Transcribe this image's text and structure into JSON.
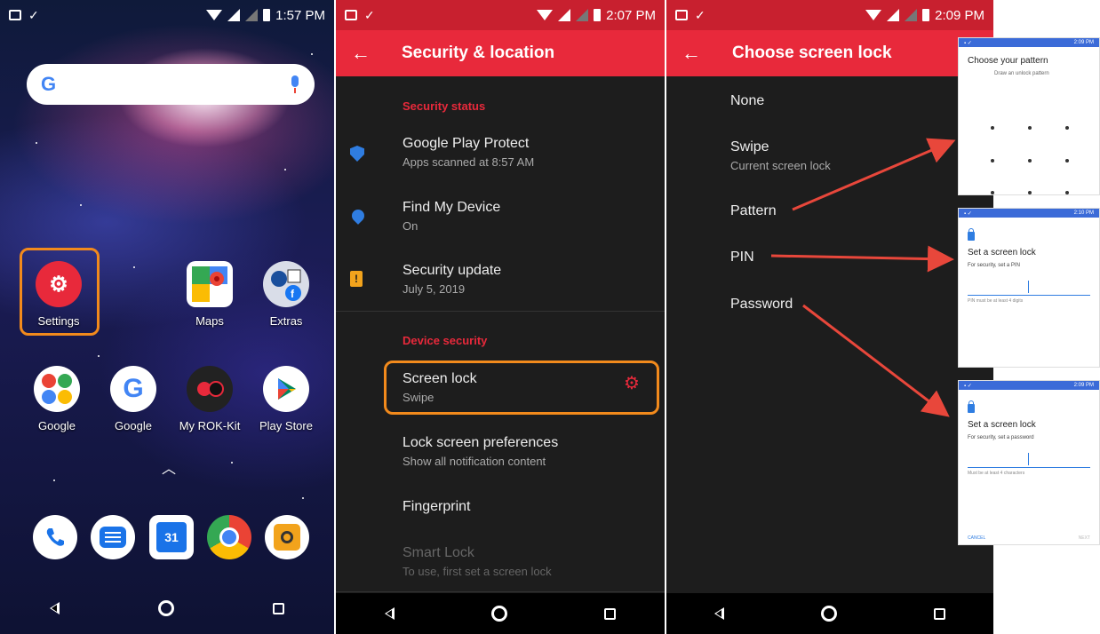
{
  "home": {
    "status_time": "1:57 PM",
    "search_logo": "G",
    "apps_row1": [
      {
        "label": "Settings"
      },
      {
        "label": "Maps"
      },
      {
        "label": "Extras"
      }
    ],
    "apps_row2": [
      {
        "label": "Google"
      },
      {
        "label": "Google"
      },
      {
        "label": "My ROK-Kit"
      },
      {
        "label": "Play Store"
      }
    ],
    "dock": [
      "phone-icon",
      "messages-icon",
      "calendar-icon",
      "chrome-icon",
      "audio-app-icon"
    ],
    "calendar_day": "31"
  },
  "security": {
    "status_time": "2:07 PM",
    "title": "Security & location",
    "section_status": "Security status",
    "items_status": [
      {
        "title": "Google Play Protect",
        "subtitle": "Apps scanned at 8:57 AM"
      },
      {
        "title": "Find My Device",
        "subtitle": "On"
      },
      {
        "title": "Security update",
        "subtitle": "July 5, 2019"
      }
    ],
    "section_device": "Device security",
    "screen_lock": {
      "title": "Screen lock",
      "subtitle": "Swipe"
    },
    "lock_prefs": {
      "title": "Lock screen preferences",
      "subtitle": "Show all notification content"
    },
    "fingerprint": {
      "title": "Fingerprint"
    },
    "smart_lock": {
      "title": "Smart Lock",
      "subtitle": "To use, first set a screen lock"
    }
  },
  "choose_lock": {
    "status_time": "2:09 PM",
    "title": "Choose screen lock",
    "options": [
      {
        "title": "None",
        "subtitle": ""
      },
      {
        "title": "Swipe",
        "subtitle": "Current screen lock"
      },
      {
        "title": "Pattern",
        "subtitle": ""
      },
      {
        "title": "PIN",
        "subtitle": ""
      },
      {
        "title": "Password",
        "subtitle": ""
      }
    ]
  },
  "thumb_pattern": {
    "time": "2:09 PM",
    "title": "Choose your pattern",
    "subtitle": "Draw an unlock pattern"
  },
  "thumb_pin": {
    "time": "2:10 PM",
    "title": "Set a screen lock",
    "subtitle": "For security, set a PIN",
    "hint": "PIN must be at least 4 digits"
  },
  "thumb_password": {
    "time": "2:09 PM",
    "title": "Set a screen lock",
    "subtitle": "For security, set a password",
    "hint": "Must be at least 4 characters",
    "cancel": "CANCEL",
    "next": "NEXT"
  },
  "colors": {
    "accent": "#e8293b",
    "highlight": "#f28a1c",
    "link": "#2f7de1"
  }
}
